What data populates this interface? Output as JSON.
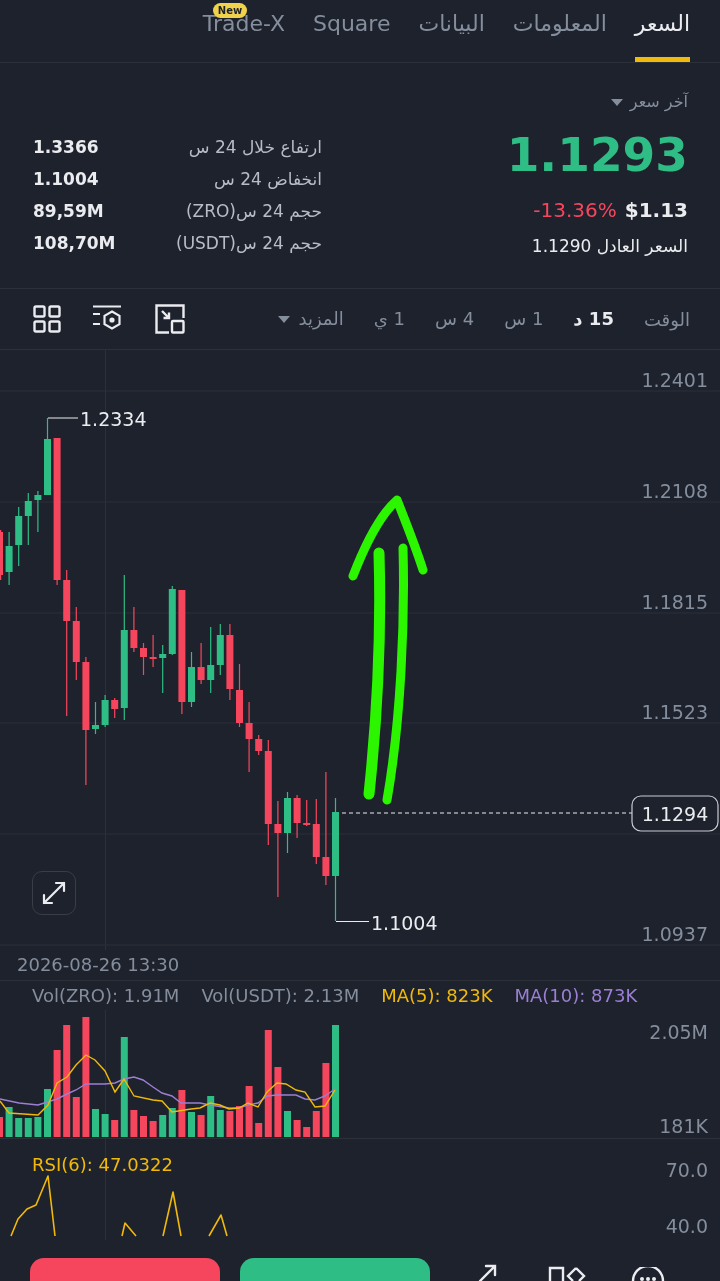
{
  "tabs": [
    {
      "label": "السعر",
      "selected": true
    },
    {
      "label": "المعلومات",
      "selected": false
    },
    {
      "label": "البيانات",
      "selected": false
    },
    {
      "label": "Square",
      "selected": false
    },
    {
      "label": "Trade-X",
      "selected": false,
      "badge": "New"
    }
  ],
  "price_panel": {
    "price_type": "آخر سعر",
    "last_price": "1.1293",
    "price_up": true,
    "usd_price": "$1.13",
    "change": "-13.36%",
    "change_up": false,
    "fair_price": "السعر العادل 1.1290"
  },
  "stats": [
    {
      "label": "ارتفاع خلال 24 س",
      "value": "1.3366"
    },
    {
      "label": "انخفاض 24 س",
      "value": "1.1004"
    },
    {
      "label": "حجم 24 س(ZRO)",
      "value": "89,59M"
    },
    {
      "label": "حجم 24 س(USDT)",
      "value": "108,70M"
    }
  ],
  "interval_bar": {
    "label": "الوقت",
    "intervals": [
      {
        "label": "15 د",
        "selected": true
      },
      {
        "label": "1 س",
        "selected": false
      },
      {
        "label": "4 س",
        "selected": false
      },
      {
        "label": "1 ي",
        "selected": false
      }
    ],
    "more": "المزيد"
  },
  "chart": {
    "price_axis": [
      "1.2401",
      "1.2108",
      "1.1815",
      "1.1523",
      "1.0937"
    ],
    "high_label": "1.2334",
    "low_label": "1.1004",
    "current_price": "1.1294",
    "timestamp": "2026-08-26 13:30"
  },
  "volume": {
    "base_volume": "Vol(ZRO): 1.91M",
    "quote_volume": "Vol(USDT): 2.13M",
    "ma_short": "MA(5): 823K",
    "ma_long": "MA(10): 873K",
    "axis": [
      "2.05M",
      "181K"
    ]
  },
  "rsi": {
    "legend": "RSI(6): 47.0322",
    "axis": [
      "70.0",
      "40.0"
    ]
  }
}
